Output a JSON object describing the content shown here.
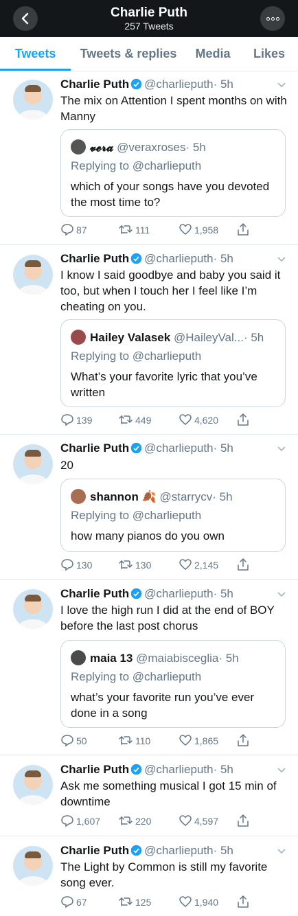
{
  "header": {
    "title": "Charlie Puth",
    "subtitle": "257 Tweets"
  },
  "tabs": [
    {
      "label": "Tweets"
    },
    {
      "label": "Tweets & replies"
    },
    {
      "label": "Media"
    },
    {
      "label": "Likes"
    }
  ],
  "colors": {
    "accent": "#1da1f2",
    "header_bg": "#14171a",
    "secondary_text": "#657786"
  },
  "tweets": [
    {
      "name": "Charlie Puth",
      "handle": "@charlieputh",
      "time": "· 5h",
      "text": "The mix on Attention I spent months on with Manny",
      "quote": {
        "name": "𝓿𝓮𝓻𝓪",
        "handle": "@veraxroses",
        "time": "· 5h",
        "replying": "Replying to @charlieputh",
        "text": "which of your songs have you devoted the most time to?"
      },
      "replies": "87",
      "retweets": "111",
      "likes": "1,958"
    },
    {
      "name": "Charlie Puth",
      "handle": "@charlieputh",
      "time": "· 5h",
      "text": "I know I said goodbye and baby you said it too, but when I touch her I feel like I’m cheating on you.",
      "quote": {
        "name": "Hailey Valasek",
        "handle": "@HaileyVal...",
        "time": "· 5h",
        "replying": "Replying to @charlieputh",
        "text": "What’s your favorite lyric that you’ve written"
      },
      "replies": "139",
      "retweets": "449",
      "likes": "4,620"
    },
    {
      "name": "Charlie Puth",
      "handle": "@charlieputh",
      "time": "· 5h",
      "text": "20",
      "quote": {
        "name": "shannon 🍂",
        "handle": "@starrycv",
        "time": "· 5h",
        "replying": "Replying to @charlieputh",
        "text": "how many pianos do you own"
      },
      "replies": "130",
      "retweets": "130",
      "likes": "2,145"
    },
    {
      "name": "Charlie Puth",
      "handle": "@charlieputh",
      "time": "· 5h",
      "text": "I love the high run I did at the end of BOY before the last post chorus",
      "quote": {
        "name": "maia 13",
        "handle": "@maiabisceglia",
        "time": "· 5h",
        "replying": "Replying to @charlieputh",
        "text": "what’s your favorite run you’ve ever done in a song"
      },
      "replies": "50",
      "retweets": "110",
      "likes": "1,865"
    },
    {
      "name": "Charlie Puth",
      "handle": "@charlieputh",
      "time": "· 5h",
      "text": "Ask me something musical I got 15 min of downtime",
      "replies": "1,607",
      "retweets": "220",
      "likes": "4,597"
    },
    {
      "name": "Charlie Puth",
      "handle": "@charlieputh",
      "time": "· 5h",
      "text": "The Light by Common is still my favorite song ever.",
      "replies": "67",
      "retweets": "125",
      "likes": "1,940"
    }
  ]
}
